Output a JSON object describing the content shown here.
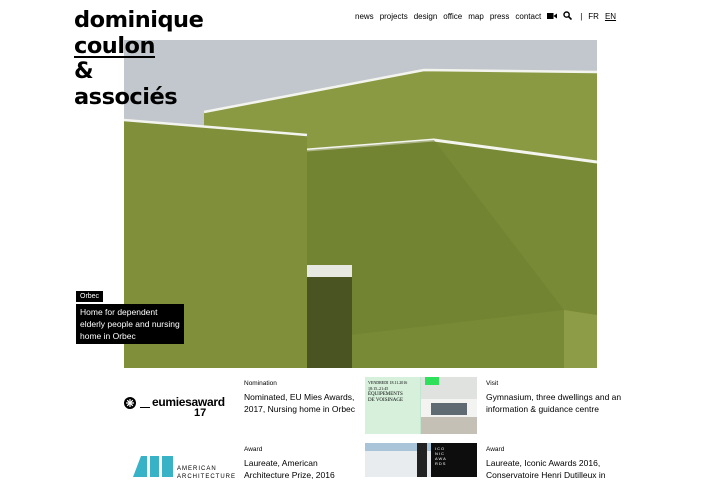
{
  "brand": {
    "line1": "dominique",
    "line2": "coulon",
    "line3": "&",
    "line4": "associés"
  },
  "nav": {
    "items": [
      "news",
      "projects",
      "design",
      "office",
      "map",
      "press",
      "contact"
    ],
    "video_icon": "video-camera-icon",
    "search_icon": "search-icon",
    "langs": [
      "FR",
      "EN"
    ],
    "active_lang": "EN"
  },
  "hero": {
    "tag": "Orbec",
    "title": "Home for dependent elderly people and nursing home in Orbec",
    "colors": {
      "sky": "#c3c8cf",
      "wall": "#7f8f3a"
    }
  },
  "news": [
    {
      "logo_text": "eumiesaward",
      "logo_sub": "17",
      "type": "Nomination",
      "text": "Nominated, EU Mies Awards, 2017, Nursing home in Orbec"
    },
    {
      "thumb_lines": [
        "VENDREDI 18.11.2016",
        "18:15–21:45",
        "ÉQUIPEMENTS",
        "DE VOISINAGE"
      ],
      "type": "Visit",
      "text": "Gymnasium, three dwellings and an information & guidance centre"
    },
    {
      "logo_text": "AMERICAN",
      "logo_sub": "ARCHITECTURE",
      "type": "Award",
      "text": "Laureate, American Architecture Prize, 2016"
    },
    {
      "thumb_lines": [
        "ICO",
        "NIC",
        "AWA",
        "RDS"
      ],
      "type": "Award",
      "text": "Laureate, Iconic Awards 2016, Conservatoire Henri Dutilleux in"
    }
  ]
}
